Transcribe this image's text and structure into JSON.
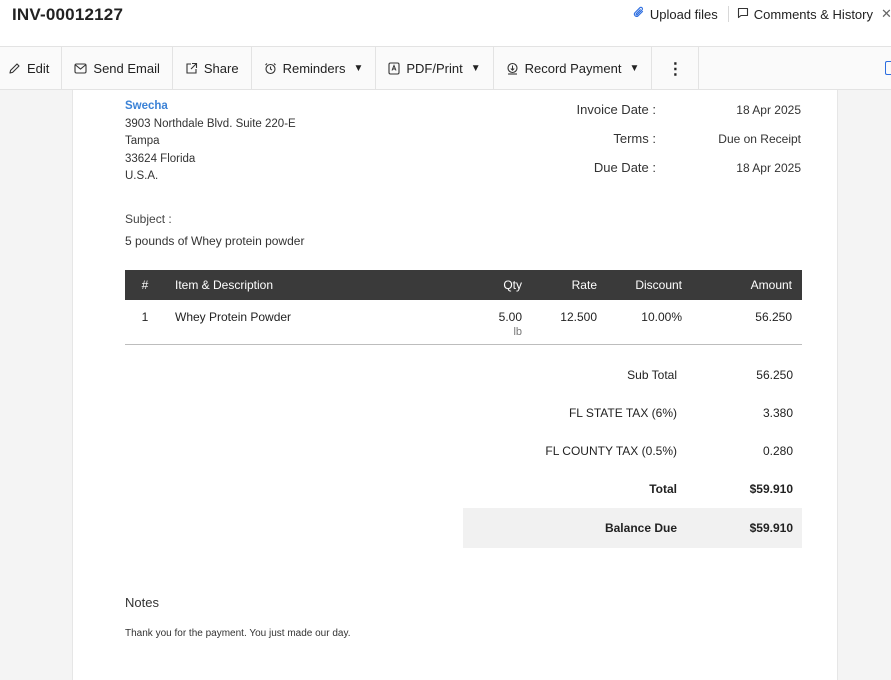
{
  "header": {
    "invoice_number": "INV-00012127",
    "upload_label": "Upload files",
    "comments_label": "Comments & History"
  },
  "toolbar": {
    "edit_label": "Edit",
    "send_email_label": "Send Email",
    "share_label": "Share",
    "reminders_label": "Reminders",
    "pdf_print_label": "PDF/Print",
    "record_payment_label": "Record Payment",
    "more_label": "⋮"
  },
  "billing": {
    "name": "Swecha",
    "address_line1": "3903 Northdale Blvd. Suite 220-E",
    "city": "Tampa",
    "zip_state": "33624 Florida",
    "country": "U.S.A."
  },
  "meta": {
    "invoice_date_label": "Invoice Date :",
    "invoice_date": "18 Apr 2025",
    "terms_label": "Terms :",
    "terms": "Due on Receipt",
    "due_date_label": "Due Date :",
    "due_date": "18 Apr 2025"
  },
  "subject": {
    "label": "Subject :",
    "text": "5 pounds of Whey protein powder"
  },
  "items_table": {
    "headers": [
      "#",
      "Item & Description",
      "Qty",
      "Rate",
      "Discount",
      "Amount"
    ],
    "rows": [
      {
        "num": "1",
        "item": "Whey Protein Powder",
        "qty": "5.00",
        "unit": "lb",
        "rate": "12.500",
        "discount": "10.00%",
        "amount": "56.250"
      }
    ]
  },
  "totals": {
    "sub_total_label": "Sub Total",
    "sub_total": "56.250",
    "state_tax_label": "FL STATE TAX (6%)",
    "state_tax": "3.380",
    "county_tax_label": "FL COUNTY TAX (0.5%)",
    "county_tax": "0.280",
    "total_label": "Total",
    "total": "$59.910",
    "balance_due_label": "Balance Due",
    "balance_due": "$59.910"
  },
  "notes": {
    "heading": "Notes",
    "text": "Thank you for the payment. You just made our day."
  },
  "colors": {
    "accent": "#2d6ee0",
    "customer_name": "#3b82d6",
    "table_header_bg": "#3a3a3a"
  },
  "icons": [
    "paperclip-icon",
    "comment-icon",
    "close-icon",
    "pencil-icon",
    "email-icon",
    "share-icon",
    "alarm-clock-icon",
    "pdf-icon",
    "payment-icon",
    "kebab-menu-icon"
  ]
}
